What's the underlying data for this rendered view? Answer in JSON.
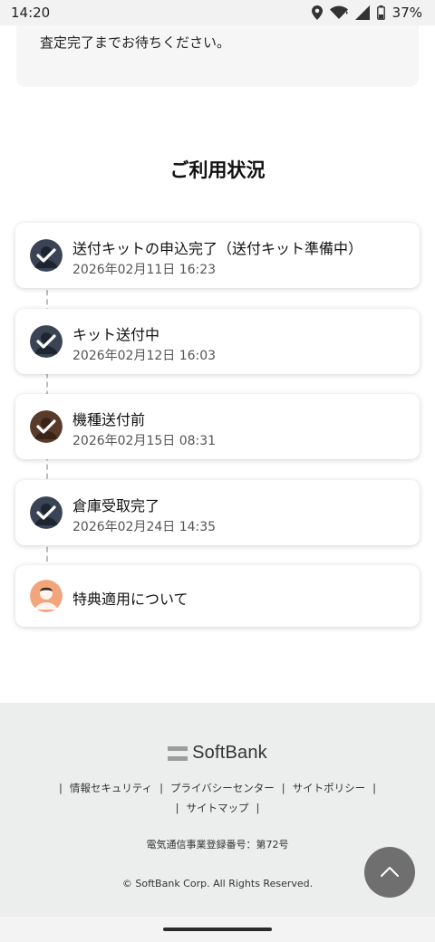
{
  "status_bar": {
    "time": "14:20",
    "battery": "37%"
  },
  "top_card": {
    "text": "査定完了までお待ちください。"
  },
  "section": {
    "title": "ご利用状況"
  },
  "timeline": [
    {
      "title": "送付キットの申込完了（送付キット準備中）",
      "date": "2026年02月11日 16:23",
      "avatar": "checked-dark-avatar"
    },
    {
      "title": "キット送付中",
      "date": "2026年02月12日 16:03",
      "avatar": "checked-dark-avatar"
    },
    {
      "title": "機種送付前",
      "date": "2026年02月15日 08:31",
      "avatar": "checked-brown-avatar"
    },
    {
      "title": "倉庫受取完了",
      "date": "2026年02月24日 14:35",
      "avatar": "checked-dark-avatar"
    },
    {
      "title": "特典適用について",
      "date": "",
      "avatar": "orange-person-avatar"
    }
  ],
  "footer": {
    "logo": "SoftBank",
    "links": [
      "情報セキュリティ",
      "プライバシーセンター",
      "サイトポリシー",
      "サイトマップ"
    ],
    "separator": "|",
    "registration": "電気通信事業登録番号：第72号",
    "copyright": "© SoftBank Corp. All Rights Reserved."
  },
  "colors": {
    "footer_bg": "#eceded",
    "scroll_button": "#6f6f6f",
    "avatar_dark": "#3a4454",
    "avatar_brown": "#5a3a2a",
    "avatar_orange": "#f2a47a"
  }
}
